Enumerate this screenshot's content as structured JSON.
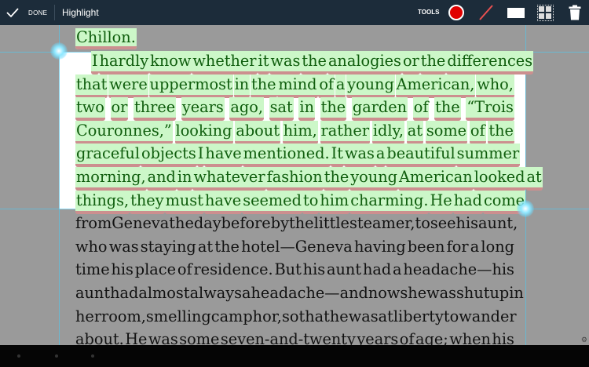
{
  "toolbar": {
    "done_label": "DONE",
    "title": "Highlight",
    "tools_label": "TOOLS",
    "colors": {
      "bar": "#1c2c3a",
      "pen": "#e00000",
      "highlight": "#ccf7c8",
      "underline": "#cc8f8f"
    }
  },
  "document": {
    "prev_line": "Chillon.",
    "highlighted_lines": [
      [
        "I",
        "hardly",
        "know",
        "whether",
        "it",
        "was",
        "the",
        "analogies",
        "or",
        "the",
        "differences"
      ],
      [
        "that",
        "were",
        "uppermost",
        "in",
        "the",
        "mind",
        "of",
        "a",
        "young",
        "American,",
        "who,"
      ],
      [
        "two",
        "or",
        "three",
        "years",
        "ago,",
        "sat",
        "in",
        "the",
        "garden",
        "of",
        "the",
        "“Trois"
      ],
      [
        "Couronnes,”",
        "looking",
        "about",
        "him,",
        "rather",
        "idly,",
        "at",
        "some",
        "of",
        "the"
      ],
      [
        "graceful",
        "objects",
        "I",
        "have",
        "mentioned.",
        "It",
        "was",
        "a",
        "beautiful",
        "summer"
      ],
      [
        "morning,",
        "and",
        "in",
        "whatever",
        "fashion",
        "the",
        "young",
        "American",
        "looked",
        "at"
      ],
      [
        "things,",
        "they",
        "must",
        "have",
        "seemed",
        "to",
        "him",
        "charming.",
        "He",
        "had",
        "come"
      ]
    ],
    "plain_lines": [
      [
        "from",
        "Geneva",
        "the",
        "day",
        "before",
        "by",
        "the",
        "little",
        "steamer,",
        "to",
        "see",
        "his",
        "aunt,"
      ],
      [
        "who",
        "was",
        "staying",
        "at",
        "the",
        "hotel—Geneva",
        "having",
        "been",
        "for",
        "a",
        "long"
      ],
      [
        "time",
        "his",
        "place",
        "of",
        "residence.",
        "",
        "But",
        "his",
        "aunt",
        "had",
        "a",
        "headache—his"
      ],
      [
        "aunt",
        "had",
        "almost",
        "always",
        "a",
        "headache—and",
        "now",
        "she",
        "was",
        "shut",
        "up",
        "in"
      ],
      [
        "her",
        "room,",
        "smelling",
        "camphor,",
        "so",
        "that",
        "he",
        "was",
        "at",
        "liberty",
        "to",
        "wander"
      ],
      [
        "about.",
        "He",
        "was",
        "some",
        "seven-and-twenty",
        "years",
        "of",
        "age;",
        "when",
        "his"
      ]
    ]
  }
}
